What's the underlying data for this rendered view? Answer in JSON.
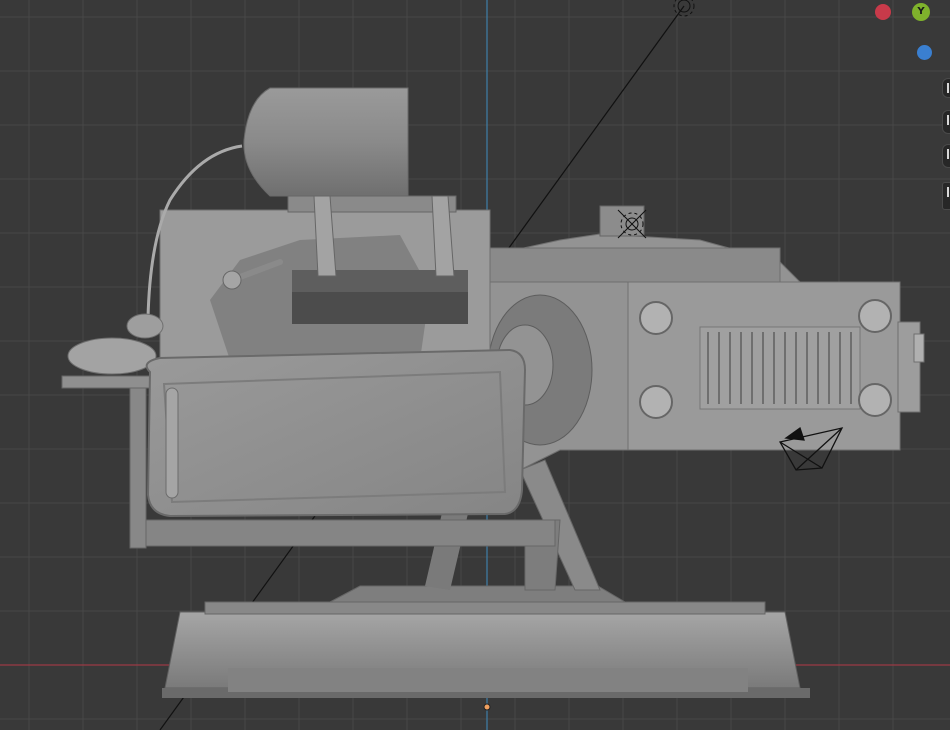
{
  "viewport": {
    "background": "#393939",
    "grid_color": "#4a4a4a",
    "axis_x_color": "#9b3a44",
    "axis_y_color": "#3f7fa8",
    "model_color": "#8e8e8e",
    "model_shadow_color": "#6c6c6c",
    "model_highlight_color": "#a8a8a8"
  },
  "gizmo": {
    "x_color": "#c83a4a",
    "y_label": "Y",
    "y_color": "#7fb22c",
    "z_color": "#3a7fd0"
  },
  "nav_buttons": [
    {
      "icon": "zoom-icon"
    },
    {
      "icon": "pan-hand-icon"
    },
    {
      "icon": "camera-view-icon"
    },
    {
      "icon": "perspective-toggle-icon"
    }
  ],
  "objects": [
    {
      "name": "model-mesh",
      "type": "mesh"
    },
    {
      "name": "camera-object",
      "type": "camera"
    },
    {
      "name": "light-object",
      "type": "light"
    },
    {
      "name": "origin-point",
      "type": "origin"
    }
  ]
}
